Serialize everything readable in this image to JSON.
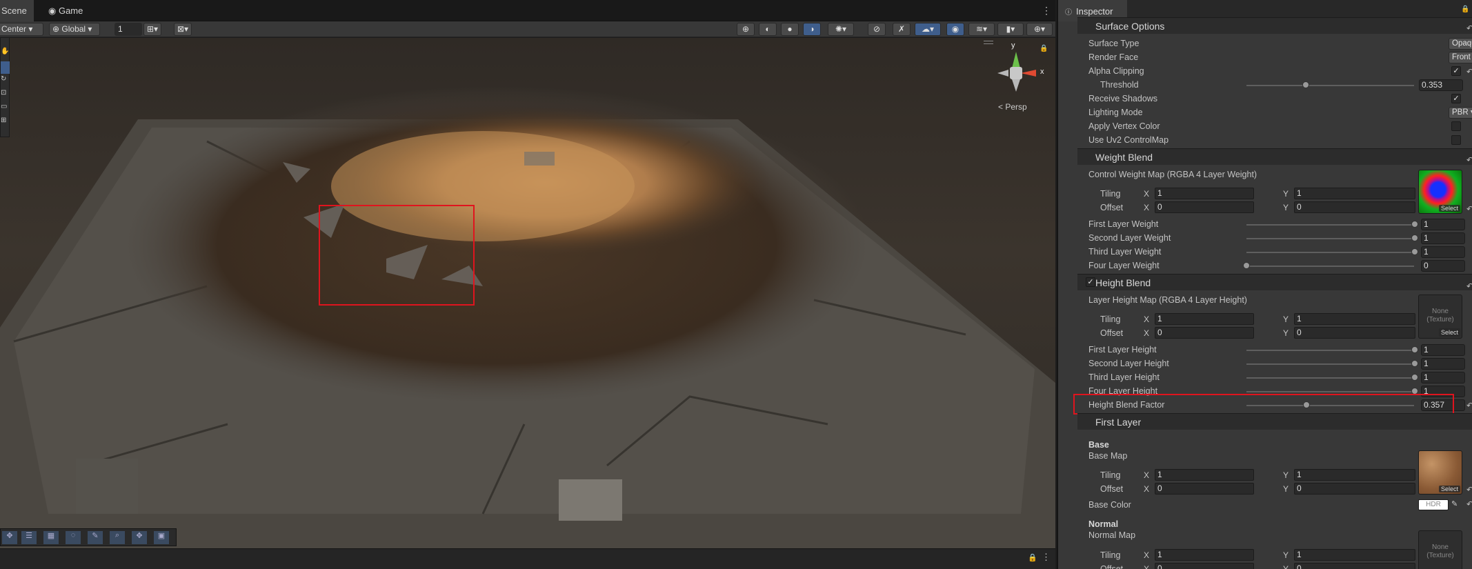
{
  "scene_tabs": {
    "scene": "Scene",
    "game": "Game"
  },
  "toolbar": {
    "pivot": "Center",
    "space": "Global",
    "grid_size": "1"
  },
  "viewport": {
    "projection": "Persp",
    "gizmo": {
      "y": "y",
      "x": "x"
    }
  },
  "inspector": {
    "title": "Inspector",
    "surface_options": {
      "header": "Surface Options",
      "surface_type_label": "Surface Type",
      "surface_type_value": "Opaque",
      "render_face_label": "Render Face",
      "render_face_value": "Front",
      "alpha_clipping_label": "Alpha Clipping",
      "alpha_clipping_checked": "✓",
      "threshold_label": "Threshold",
      "threshold_value": "0.353",
      "threshold_fraction": 0.353,
      "receive_shadows_label": "Receive Shadows",
      "receive_shadows_checked": "✓",
      "lighting_mode_label": "Lighting Mode",
      "lighting_mode_value": "PBR",
      "apply_vertex_color_label": "Apply Vertex Color",
      "use_uv2_label": "Use Uv2 ControlMap"
    },
    "weight_blend": {
      "header": "Weight Blend",
      "control_map_label": "Control Weight Map (RGBA 4 Layer Weight)",
      "tiling_label": "Tiling",
      "offset_label": "Offset",
      "tiling_x": "1",
      "tiling_y": "1",
      "offset_x": "0",
      "offset_y": "0",
      "first_label": "First Layer Weight",
      "first_value": "1",
      "second_label": "Second Layer Weight",
      "second_value": "1",
      "third_label": "Third Layer Weight",
      "third_value": "1",
      "four_label": "Four Layer Weight",
      "four_value": "0",
      "select_label": "Select"
    },
    "height_blend": {
      "header": "Height Blend",
      "checked": "✓",
      "map_label": "Layer Height Map (RGBA 4 Layer Height)",
      "tiling_label": "Tiling",
      "offset_label": "Offset",
      "tiling_x": "1",
      "tiling_y": "1",
      "offset_x": "0",
      "offset_y": "0",
      "none_texture": "None\n(Texture)",
      "select_label": "Select",
      "first_label": "First Layer Height",
      "first_value": "1",
      "second_label": "Second Layer Height",
      "second_value": "1",
      "third_label": "Third Layer Height",
      "third_value": "1",
      "four_label": "Four Layer Height",
      "four_value": "1",
      "factor_label": "Height Blend Factor",
      "factor_value": "0.357",
      "factor_fraction": 0.357
    },
    "first_layer": {
      "header": "First Layer",
      "base_group": "Base",
      "base_map_label": "Base Map",
      "tiling_label": "Tiling",
      "offset_label": "Offset",
      "tiling_x": "1",
      "tiling_y": "1",
      "offset_x": "0",
      "offset_y": "0",
      "select_label": "Select",
      "base_color_label": "Base Color",
      "hdr_label": "HDR",
      "normal_group": "Normal",
      "normal_map_label": "Normal Map",
      "normal_tiling_x": "1",
      "normal_tiling_y": "1",
      "normal_offset_x": "0",
      "normal_offset_y": "0",
      "none_texture": "None\n(Texture)"
    },
    "xy": {
      "x": "X",
      "y": "Y"
    }
  },
  "colors": {
    "highlight": "#e0141e",
    "accent_blue": "#3f5e8c"
  }
}
